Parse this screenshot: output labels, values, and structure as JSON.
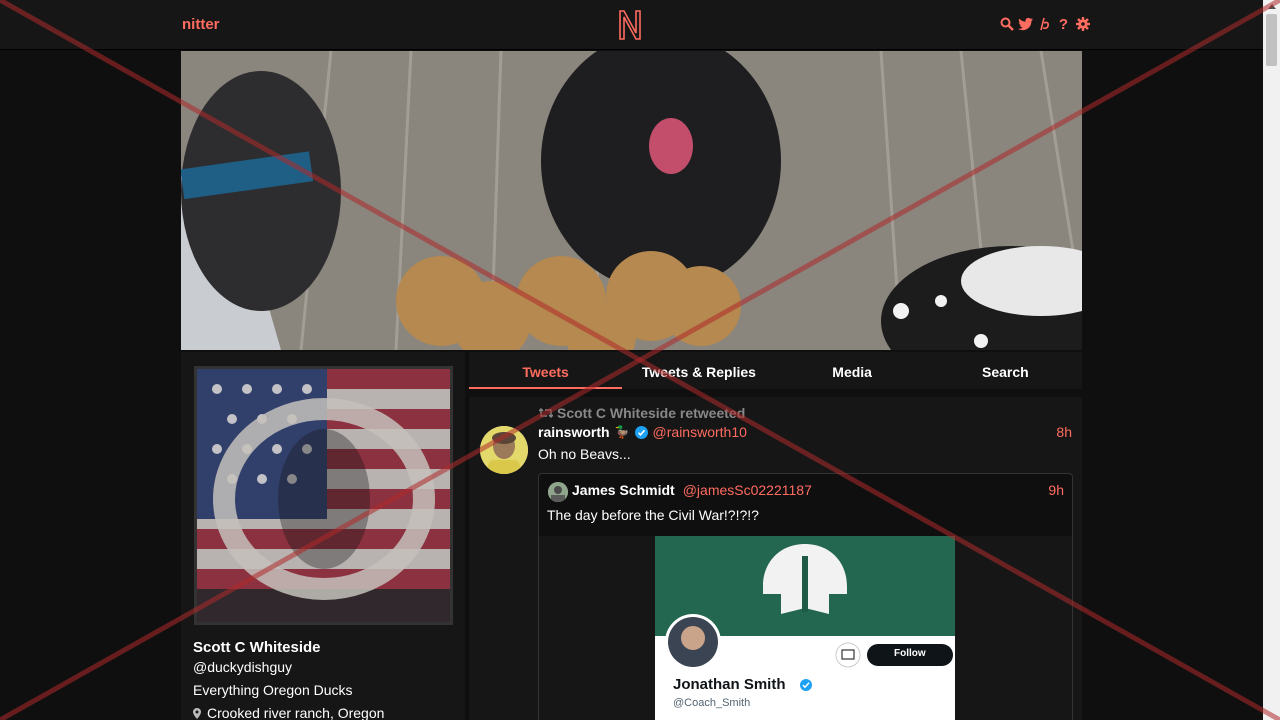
{
  "nav": {
    "brand": "nitter",
    "icons": [
      "search-icon",
      "twitter-icon",
      "rss-icon",
      "help-icon",
      "settings-icon"
    ]
  },
  "colors": {
    "accent": "#ff6c60",
    "background": "#0f0f0f",
    "panel": "#161616"
  },
  "profile": {
    "fullname": "Scott C Whiteside",
    "username": "@duckydishguy",
    "bio": "Everything Oregon Ducks",
    "location": "Crooked river ranch, Oregon"
  },
  "tabs": [
    {
      "label": "Tweets",
      "active": true
    },
    {
      "label": "Tweets & Replies",
      "active": false
    },
    {
      "label": "Media",
      "active": false
    },
    {
      "label": "Search",
      "active": false
    }
  ],
  "tweet": {
    "retweet_header": "Scott C Whiteside retweeted",
    "fullname": "rainsworth",
    "username": "@rainsworth10",
    "date": "8h",
    "body": "Oh no Beavs...",
    "quote": {
      "fullname": "James Schmidt",
      "username": "@jamesSc02221187",
      "date": "9h",
      "body": "The day before the Civil War!?!?!?",
      "media": {
        "name": "Jonathan Smith",
        "handle": "@Coach_Smith",
        "follow_label": "Follow"
      }
    }
  }
}
